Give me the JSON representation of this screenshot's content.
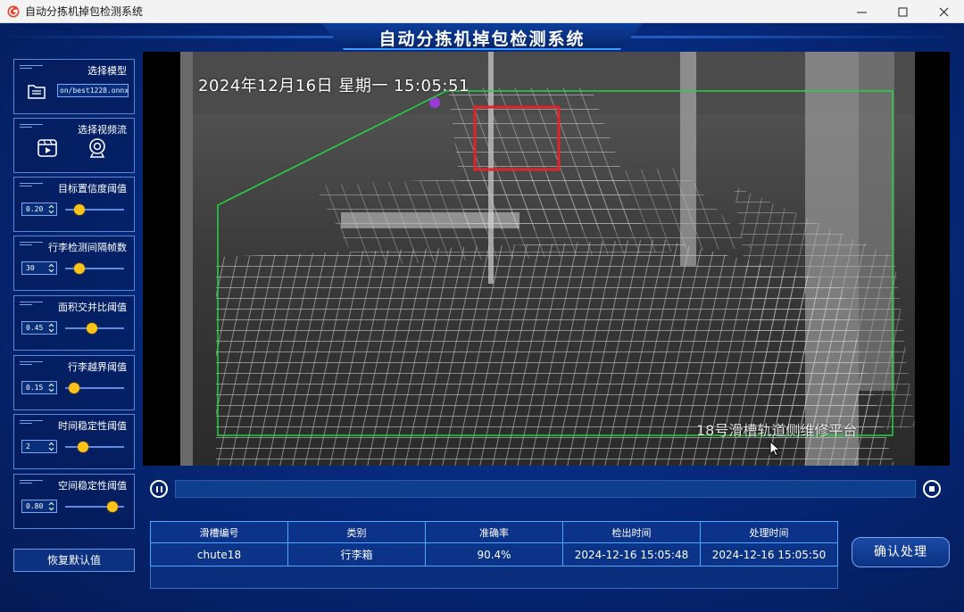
{
  "window": {
    "title": "自动分拣机掉包检测系统",
    "controls": [
      "minimize-icon",
      "maximize-icon",
      "close-icon"
    ]
  },
  "header": {
    "title": "自动分拣机掉包检测系统"
  },
  "sidebar": {
    "model": {
      "title": "选择模型",
      "path": "on/best1228.onnx",
      "icon": "folder-document-icon"
    },
    "video_source": {
      "title": "选择视频流",
      "icons": [
        "video-file-icon",
        "webcam-icon"
      ]
    },
    "params": [
      {
        "id": "confidence",
        "title": "目标置信度阈值",
        "value": "0.20",
        "level": 0.24
      },
      {
        "id": "interval",
        "title": "行李检测间隔帧数",
        "value": "30",
        "level": 0.24
      },
      {
        "id": "iou",
        "title": "面积交并比阈值",
        "value": "0.45",
        "level": 0.45
      },
      {
        "id": "boundary",
        "title": "行李越界阈值",
        "value": "0.15",
        "level": 0.15
      },
      {
        "id": "temporal",
        "title": "时间稳定性阈值",
        "value": "2",
        "level": 0.3
      },
      {
        "id": "spatial",
        "title": "空间稳定性阈值",
        "value": "0.80",
        "level": 0.8
      }
    ],
    "reset_label": "恢复默认值"
  },
  "video": {
    "timestamp": "2024年12月16日  星期一  15:05:51",
    "watermark": "18号滑槽轨道侧维修平台"
  },
  "player": {
    "progress": 0
  },
  "results": {
    "columns": [
      "滑槽编号",
      "类别",
      "准确率",
      "检出时间",
      "处理时间"
    ],
    "rows": [
      [
        "chute18",
        "行李箱",
        "90.4%",
        "2024-12-16 15:05:48",
        "2024-12-16 15:05:50"
      ]
    ]
  },
  "confirm_label": "确认处理",
  "colors": {
    "accent": "#3d9bff",
    "knob": "#ffc31a",
    "roi": "#22d640",
    "detection": "#e0242a"
  }
}
